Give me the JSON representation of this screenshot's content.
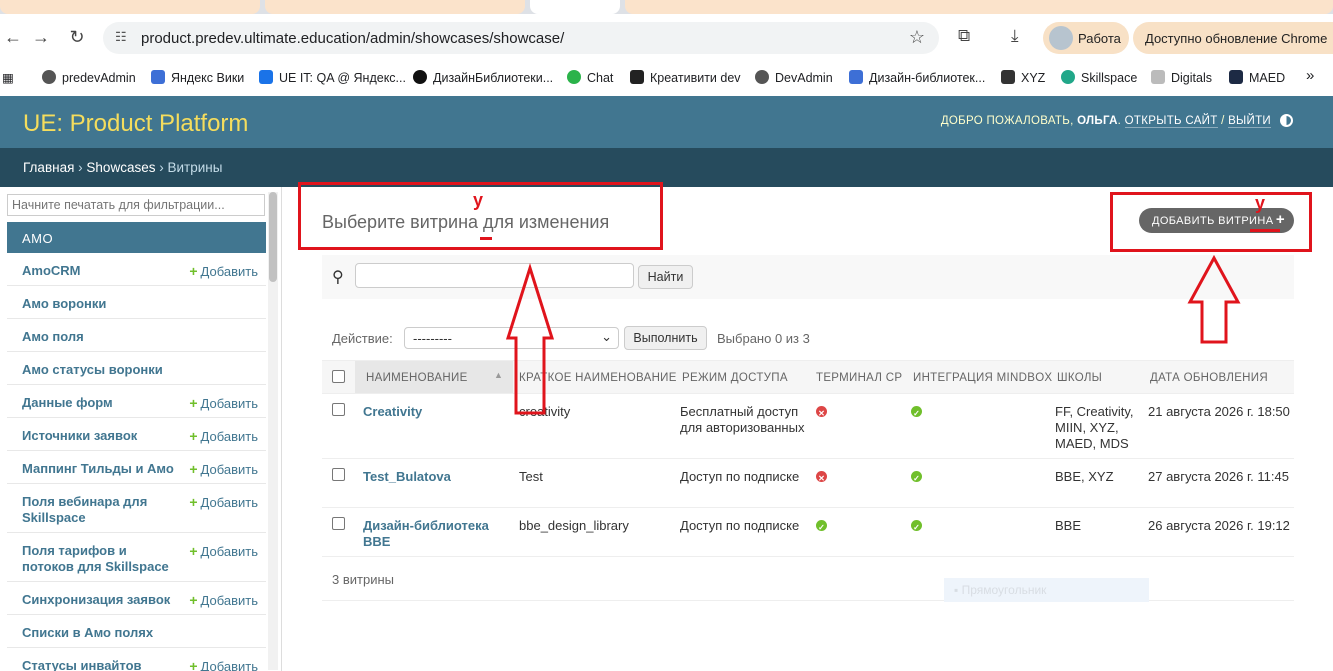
{
  "browser": {
    "url": "product.predev.ultimate.education/admin/showcases/showcase/",
    "profile_label": "Работа",
    "update_label": "Доступно обновление Chrome",
    "bookmarks": [
      "predevAdmin",
      "Яндекс Вики",
      "UE IT: QA @ Яндекс...",
      "ДизайнБиблиотеки...",
      "Chat",
      "Креативити dev",
      "DevAdmin",
      "Дизайн-библиотек...",
      "XYZ",
      "Skillspace",
      "Digitals",
      "MAED"
    ],
    "bookmarks_overflow": "»"
  },
  "admin": {
    "site_name": "UE: Product Platform",
    "welcome": "ДОБРО ПОЖАЛОВАТЬ,",
    "user": "ОЛЬГА",
    "view_site": "ОТКРЫТЬ САЙТ",
    "separator": "/",
    "logout": "ВЫЙТИ",
    "breadcrumbs": {
      "home": "Главная",
      "app": "Showcases",
      "current": "Витрины",
      "sep": "›"
    }
  },
  "sidebar": {
    "filter_placeholder": "Начните печатать для фильтрации...",
    "section": "АМО",
    "add_label": "Добавить",
    "items": [
      {
        "label": "AmoCRM",
        "add": true
      },
      {
        "label": "Амо воронки",
        "add": false
      },
      {
        "label": "Амо поля",
        "add": false
      },
      {
        "label": "Амо статусы воронки",
        "add": false
      },
      {
        "label": "Данные форм",
        "add": true
      },
      {
        "label": "Источники заявок",
        "add": true
      },
      {
        "label": "Маппинг Тильды и Амо",
        "add": true
      },
      {
        "label": "Поля вебинара для Skillspace",
        "add": true
      },
      {
        "label": "Поля тарифов и потоков для Skillspace",
        "add": true
      },
      {
        "label": "Синхронизация заявок",
        "add": true
      },
      {
        "label": "Списки в Амо полях",
        "add": false
      },
      {
        "label": "Статусы инвайтов",
        "add": true
      }
    ]
  },
  "main": {
    "title": "Выберите витрина для изменения",
    "add_button": "ДОБАВИТЬ ВИТРИНА",
    "search_button": "Найти",
    "action_label": "Действие:",
    "action_selected": "---------",
    "go_button": "Выполнить",
    "selected_counter": "Выбрано 0 из 3",
    "columns": [
      "НАИМЕНОВАНИЕ",
      "КРАТКОЕ НАИМЕНОВАНИЕ",
      "РЕЖИМ ДОСТУПА",
      "ТЕРМИНАЛ CP",
      "ИНТЕГРАЦИЯ MINDBOX",
      "ШКОЛЫ",
      "ДАТА ОБНОВЛЕНИЯ"
    ],
    "rows": [
      {
        "name": "Creativity",
        "short": "creativity",
        "access": "Бесплатный доступ для авторизованных",
        "terminal": false,
        "mindbox": true,
        "schools": "FF, Creativity, MIIN, XYZ, MAED, MDS",
        "updated": "21 августа 2026 г. 18:50"
      },
      {
        "name": "Test_Bulatova",
        "short": "Test",
        "access": "Доступ по подписке",
        "terminal": false,
        "mindbox": true,
        "schools": "BBE, XYZ",
        "updated": "27 августа 2026 г. 11:45"
      },
      {
        "name": "Дизайн-библиотека BBE",
        "short": "bbe_design_library",
        "access": "Доступ по подписке",
        "terminal": true,
        "mindbox": true,
        "schools": "BBE",
        "updated": "26 августа 2026 г. 19:12"
      }
    ],
    "result_count": "3 витрины",
    "ghost_text": "Прямоугольник"
  },
  "annotations": {
    "letter": "у",
    "color": "#e0141c"
  }
}
